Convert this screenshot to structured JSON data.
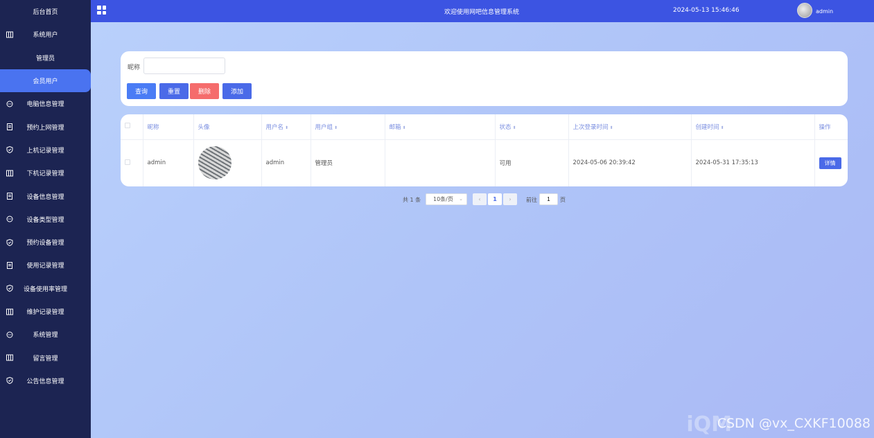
{
  "sidebar": {
    "items": [
      {
        "label": "后台首页",
        "icon": ""
      },
      {
        "label": "系统用户",
        "icon": "columns-icon"
      },
      {
        "label": "管理员",
        "icon": ""
      },
      {
        "label": "会员用户",
        "icon": "",
        "active": true
      },
      {
        "label": "电脑信息管理",
        "icon": "chat-icon"
      },
      {
        "label": "预约上网管理",
        "icon": "document-icon"
      },
      {
        "label": "上机记录管理",
        "icon": "shield-icon"
      },
      {
        "label": "下机记录管理",
        "icon": "columns-icon"
      },
      {
        "label": "设备信息管理",
        "icon": "document-icon"
      },
      {
        "label": "设备类型管理",
        "icon": "chat-icon"
      },
      {
        "label": "预约设备管理",
        "icon": "shield-icon"
      },
      {
        "label": "使用记录管理",
        "icon": "document-icon"
      },
      {
        "label": "设备使用率管理",
        "icon": "shield-icon"
      },
      {
        "label": "维护记录管理",
        "icon": "columns-icon"
      },
      {
        "label": "系统管理",
        "icon": "chat-icon"
      },
      {
        "label": "留言管理",
        "icon": "columns-icon"
      },
      {
        "label": "公告信息管理",
        "icon": "shield-icon"
      }
    ]
  },
  "header": {
    "title": "欢迎使用网吧信息管理系统",
    "datetime": "2024-05-13 15:46:46",
    "username": "admin"
  },
  "search": {
    "label": "昵称",
    "value": "",
    "buttons": {
      "query": "查询",
      "reset": "重置",
      "delete": "删除",
      "add": "添加"
    }
  },
  "table": {
    "columns": [
      "昵称",
      "头像",
      "用户名",
      "用户组",
      "邮箱",
      "状态",
      "上次登录时间",
      "创建时间",
      "操作"
    ],
    "rows": [
      {
        "nickname": "admin",
        "username": "admin",
        "group": "管理员",
        "email": "",
        "status": "可用",
        "last_login": "2024-05-06 20:39:42",
        "created": "2024-05-31 17:35:13",
        "action": "详情"
      }
    ]
  },
  "pagination": {
    "total_text": "共 1 条",
    "page_size": "10条/页",
    "current_page": "1",
    "goto_label": "前往",
    "goto_value": "1",
    "unit": "页"
  },
  "watermark": {
    "text": "CSDN @vx_CXKF10088",
    "logo": "iQM"
  },
  "colors": {
    "sidebar_bg": "#1c2452",
    "topbar_bg": "#3c54e2",
    "active_item": "#4a73f0",
    "danger": "#f56c6c",
    "primary": "#4a6ae8"
  }
}
